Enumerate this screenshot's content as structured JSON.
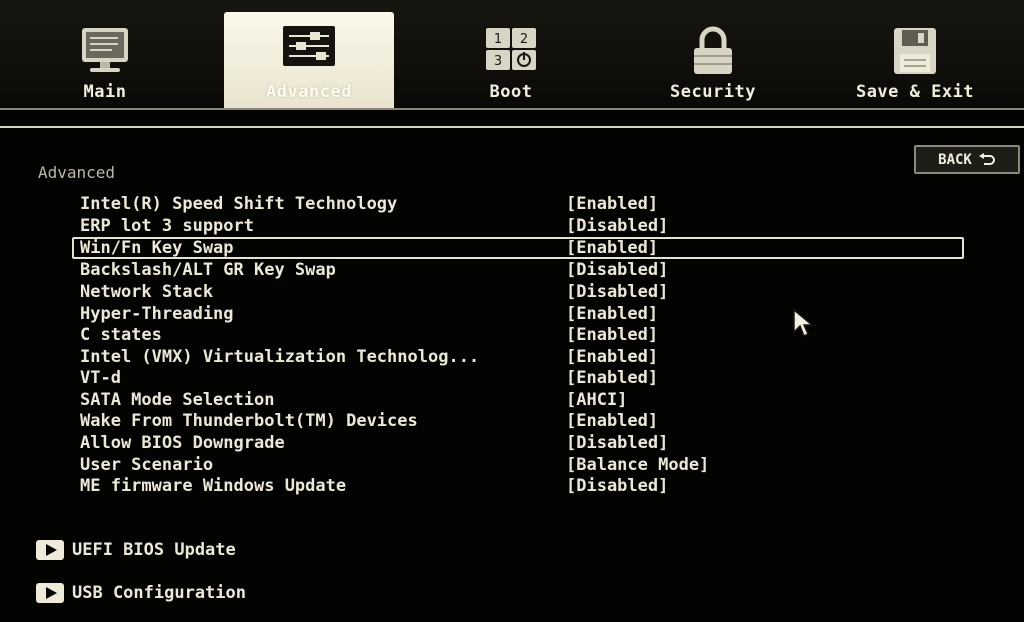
{
  "tabs": [
    {
      "label": "Main",
      "icon": "monitor-icon"
    },
    {
      "label": "Advanced",
      "icon": "sliders-icon",
      "active": true
    },
    {
      "label": "Boot",
      "icon": "boot-grid-icon"
    },
    {
      "label": "Security",
      "icon": "padlock-icon"
    },
    {
      "label": "Save & Exit",
      "icon": "floppy-disk-icon"
    }
  ],
  "section_title": "Advanced",
  "back_label": "BACK",
  "settings": [
    {
      "name": "Intel(R) Speed Shift Technology",
      "value": "[Enabled]"
    },
    {
      "name": "ERP lot 3 support",
      "value": "[Disabled]"
    },
    {
      "name": "Win/Fn Key Swap",
      "value": "[Enabled]",
      "selected": true
    },
    {
      "name": "Backslash/ALT GR Key Swap",
      "value": "[Disabled]"
    },
    {
      "name": "Network Stack",
      "value": "[Disabled]"
    },
    {
      "name": "Hyper-Threading",
      "value": "[Enabled]"
    },
    {
      "name": "C states",
      "value": "[Enabled]"
    },
    {
      "name": "Intel (VMX) Virtualization Technolog...",
      "value": "[Enabled]"
    },
    {
      "name": "VT-d",
      "value": "[Enabled]"
    },
    {
      "name": "SATA Mode Selection",
      "value": "[AHCI]"
    },
    {
      "name": "Wake From Thunderbolt(TM) Devices",
      "value": "[Enabled]"
    },
    {
      "name": "Allow BIOS Downgrade",
      "value": "[Disabled]"
    },
    {
      "name": "User Scenario",
      "value": "[Balance Mode]"
    },
    {
      "name": "ME firmware Windows Update",
      "value": "[Disabled]"
    }
  ],
  "submenus": [
    {
      "label": "UEFI BIOS Update"
    },
    {
      "label": "USB Configuration"
    }
  ],
  "colors": {
    "background": "#030302",
    "text": "#ece8d8",
    "active_tab": "#f4f0df"
  }
}
